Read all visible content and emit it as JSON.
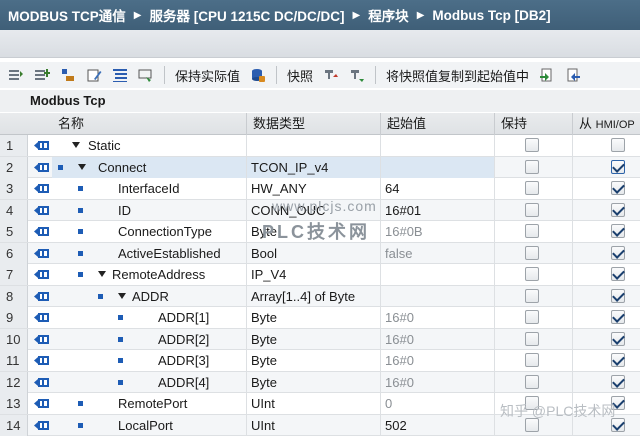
{
  "breadcrumb": [
    {
      "label": "MODBUS TCP通信"
    },
    {
      "label": "服务器 [CPU 1215C DC/DC/DC]"
    },
    {
      "label": "程序块"
    },
    {
      "label": "Modbus Tcp [DB2]"
    }
  ],
  "toolbar": {
    "keep_actual_label": "保持实际值",
    "snapshot_label": "快照",
    "copy_snapshot_label": "将快照值复制到起始值中"
  },
  "block_name": "Modbus Tcp",
  "columns": {
    "name": "名称",
    "datatype": "数据类型",
    "start": "起始值",
    "retain": "保持",
    "hmi_a": "从",
    "hmi_b": "HMI/OP"
  },
  "rows": [
    {
      "num": "1",
      "name": "Static",
      "type": "",
      "start": "",
      "retain": false,
      "hmi": false
    },
    {
      "num": "2",
      "name": "Connect",
      "type": "TCON_IP_v4",
      "start": "",
      "retain": false,
      "hmi": true
    },
    {
      "num": "3",
      "name": "InterfaceId",
      "type": "HW_ANY",
      "start": "64",
      "retain": false,
      "hmi": true
    },
    {
      "num": "4",
      "name": "ID",
      "type": "CONN_OUC",
      "start": "16#01",
      "retain": false,
      "hmi": true
    },
    {
      "num": "5",
      "name": "ConnectionType",
      "type": "Byte",
      "start": "16#0B",
      "retain": false,
      "hmi": true
    },
    {
      "num": "6",
      "name": "ActiveEstablished",
      "type": "Bool",
      "start": "false",
      "retain": false,
      "hmi": true
    },
    {
      "num": "7",
      "name": "RemoteAddress",
      "type": "IP_V4",
      "start": "",
      "retain": false,
      "hmi": true
    },
    {
      "num": "8",
      "name": "ADDR",
      "type": "Array[1..4] of Byte",
      "start": "",
      "retain": false,
      "hmi": true
    },
    {
      "num": "9",
      "name": "ADDR[1]",
      "type": "Byte",
      "start": "16#0",
      "retain": false,
      "hmi": true
    },
    {
      "num": "10",
      "name": "ADDR[2]",
      "type": "Byte",
      "start": "16#0",
      "retain": false,
      "hmi": true
    },
    {
      "num": "11",
      "name": "ADDR[3]",
      "type": "Byte",
      "start": "16#0",
      "retain": false,
      "hmi": true
    },
    {
      "num": "12",
      "name": "ADDR[4]",
      "type": "Byte",
      "start": "16#0",
      "retain": false,
      "hmi": true
    },
    {
      "num": "13",
      "name": "RemotePort",
      "type": "UInt",
      "start": "0",
      "retain": false,
      "hmi": true
    },
    {
      "num": "14",
      "name": "LocalPort",
      "type": "UInt",
      "start": "502",
      "retain": false,
      "hmi": true
    }
  ],
  "watermark": {
    "line1": "www.plcjs.com",
    "line2": "PLC技术网"
  },
  "zhihu_mark": "知乎 @PLC技术网",
  "colors": {
    "title_bar": "#46677f",
    "accent_blue": "#1d5cb5"
  }
}
